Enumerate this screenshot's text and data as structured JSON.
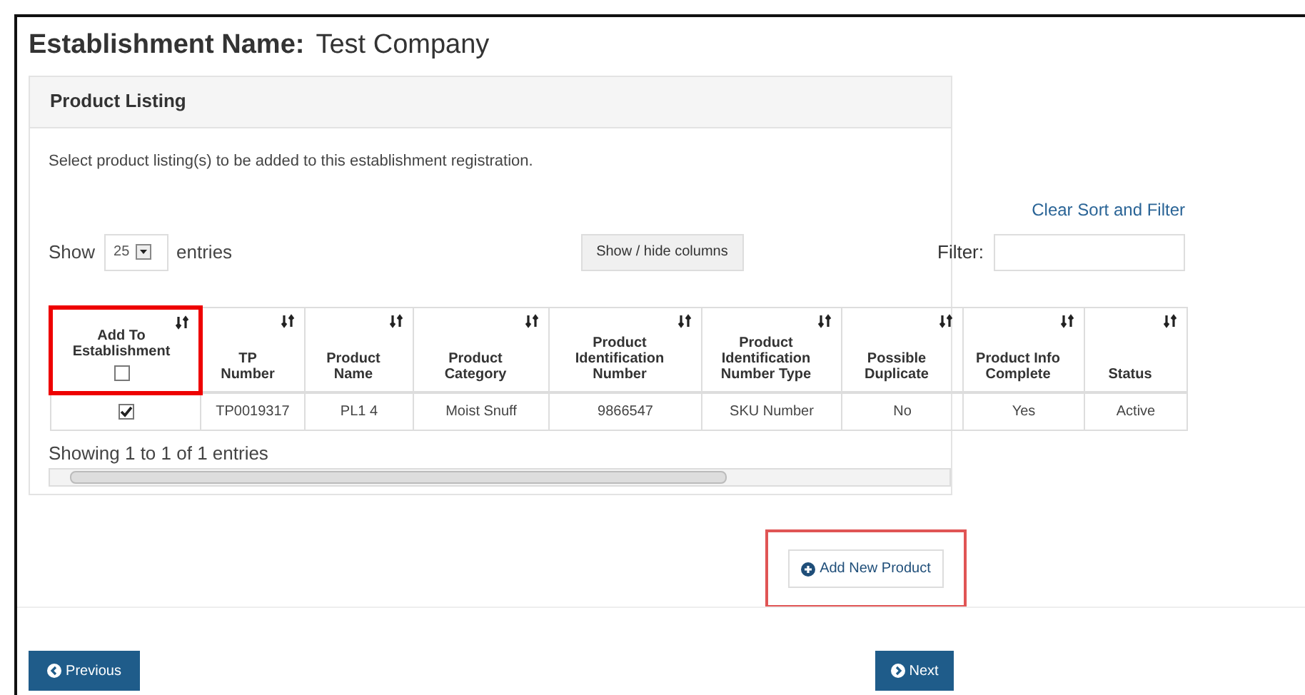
{
  "establishment": {
    "label": "Establishment Name:",
    "value": "Test Company"
  },
  "panel": {
    "title": "Product Listing",
    "instruction": "Select product listing(s) to be added to this establishment registration.",
    "clear_link": "Clear Sort and Filter",
    "length": {
      "prefix": "Show",
      "value": "25",
      "suffix": "entries"
    },
    "columns_button": "Show / hide columns",
    "filter": {
      "label": "Filter:"
    },
    "table": {
      "columns": [
        {
          "label": "Add To Establishment",
          "kind": "checkbox",
          "checked": false,
          "highlighted": true
        },
        {
          "label": "TP Number",
          "kind": "text",
          "highlighted": false
        },
        {
          "label": "Product Name",
          "kind": "text",
          "highlighted": false
        },
        {
          "label": "Product Category",
          "kind": "text",
          "highlighted": false
        },
        {
          "label": "Product Identification Number",
          "kind": "text",
          "highlighted": false
        },
        {
          "label": "Product Identification Number Type",
          "kind": "text",
          "highlighted": false
        },
        {
          "label": "Possible Duplicate",
          "kind": "text",
          "highlighted": false
        },
        {
          "label": "Product Info Complete",
          "kind": "text",
          "highlighted": false
        },
        {
          "label": "Status",
          "kind": "text",
          "highlighted": false
        }
      ],
      "rows": [
        {
          "cells": [
            {
              "kind": "checkbox",
              "checked": true
            },
            {
              "kind": "text",
              "text": "TP0019317"
            },
            {
              "kind": "text",
              "text": "PL1 4"
            },
            {
              "kind": "text",
              "text": "Moist Snuff"
            },
            {
              "kind": "text",
              "text": "9866547"
            },
            {
              "kind": "text",
              "text": "SKU Number"
            },
            {
              "kind": "text",
              "text": "No"
            },
            {
              "kind": "text",
              "text": "Yes"
            },
            {
              "kind": "text",
              "text": "Active"
            }
          ]
        }
      ]
    },
    "info": "Showing 1 to 1 of 1 entries"
  },
  "add_button": {
    "label": "Add New Product",
    "highlighted": true
  },
  "nav": {
    "previous": "Previous",
    "next": "Next"
  }
}
